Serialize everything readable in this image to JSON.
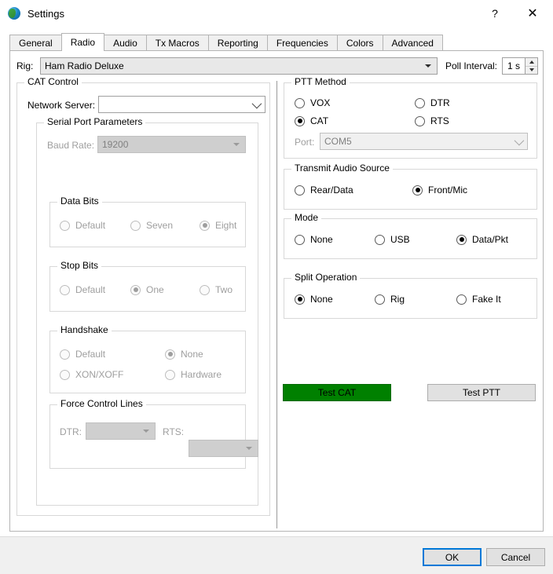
{
  "window": {
    "title": "Settings",
    "icon": "globe-icon",
    "help_label": "?",
    "close_label": "✕"
  },
  "tabs": [
    {
      "label": "General",
      "active": false
    },
    {
      "label": "Radio",
      "active": true
    },
    {
      "label": "Audio",
      "active": false
    },
    {
      "label": "Tx Macros",
      "active": false
    },
    {
      "label": "Reporting",
      "active": false
    },
    {
      "label": "Frequencies",
      "active": false
    },
    {
      "label": "Colors",
      "active": false
    },
    {
      "label": "Advanced",
      "active": false
    }
  ],
  "rig_row": {
    "label": "Rig:",
    "value": "Ham Radio Deluxe",
    "poll_label": "Poll Interval:",
    "poll_value": "1 s"
  },
  "cat_control": {
    "title": "CAT Control",
    "network_server": {
      "label": "Network Server:",
      "value": "",
      "placeholder": ""
    },
    "serial_port_parameters": {
      "title": "Serial Port Parameters",
      "baud_rate": {
        "label": "Baud Rate:",
        "value": "19200"
      },
      "data_bits": {
        "title": "Data Bits",
        "options": [
          {
            "label": "Default",
            "checked": false
          },
          {
            "label": "Seven",
            "checked": false
          },
          {
            "label": "Eight",
            "checked": true
          }
        ]
      },
      "stop_bits": {
        "title": "Stop Bits",
        "options": [
          {
            "label": "Default",
            "checked": false
          },
          {
            "label": "One",
            "checked": true
          },
          {
            "label": "Two",
            "checked": false
          }
        ]
      },
      "handshake": {
        "title": "Handshake",
        "options": [
          {
            "label": "Default",
            "checked": false
          },
          {
            "label": "None",
            "checked": true
          },
          {
            "label": "XON/XOFF",
            "checked": false
          },
          {
            "label": "Hardware",
            "checked": false
          }
        ]
      },
      "force_control_lines": {
        "title": "Force Control Lines",
        "dtr_label": "DTR:",
        "dtr_value": "",
        "rts_label": "RTS:",
        "rts_value": ""
      }
    }
  },
  "ptt_method": {
    "title": "PTT Method",
    "options": [
      {
        "label": "VOX",
        "checked": false
      },
      {
        "label": "DTR",
        "checked": false
      },
      {
        "label": "CAT",
        "checked": true
      },
      {
        "label": "RTS",
        "checked": false
      }
    ],
    "port_label": "Port:",
    "port_value": "COM5"
  },
  "transmit_audio_source": {
    "title": "Transmit Audio Source",
    "options": [
      {
        "label": "Rear/Data",
        "checked": false
      },
      {
        "label": "Front/Mic",
        "checked": true
      }
    ]
  },
  "mode": {
    "title": "Mode",
    "options": [
      {
        "label": "None",
        "checked": false
      },
      {
        "label": "USB",
        "checked": false
      },
      {
        "label": "Data/Pkt",
        "checked": true
      }
    ]
  },
  "split_operation": {
    "title": "Split Operation",
    "options": [
      {
        "label": "None",
        "checked": true
      },
      {
        "label": "Rig",
        "checked": false
      },
      {
        "label": "Fake It",
        "checked": false
      }
    ]
  },
  "test_buttons": {
    "test_cat": "Test CAT",
    "test_ptt": "Test PTT",
    "test_cat_color": "#008000"
  },
  "footer": {
    "ok": "OK",
    "cancel": "Cancel"
  }
}
